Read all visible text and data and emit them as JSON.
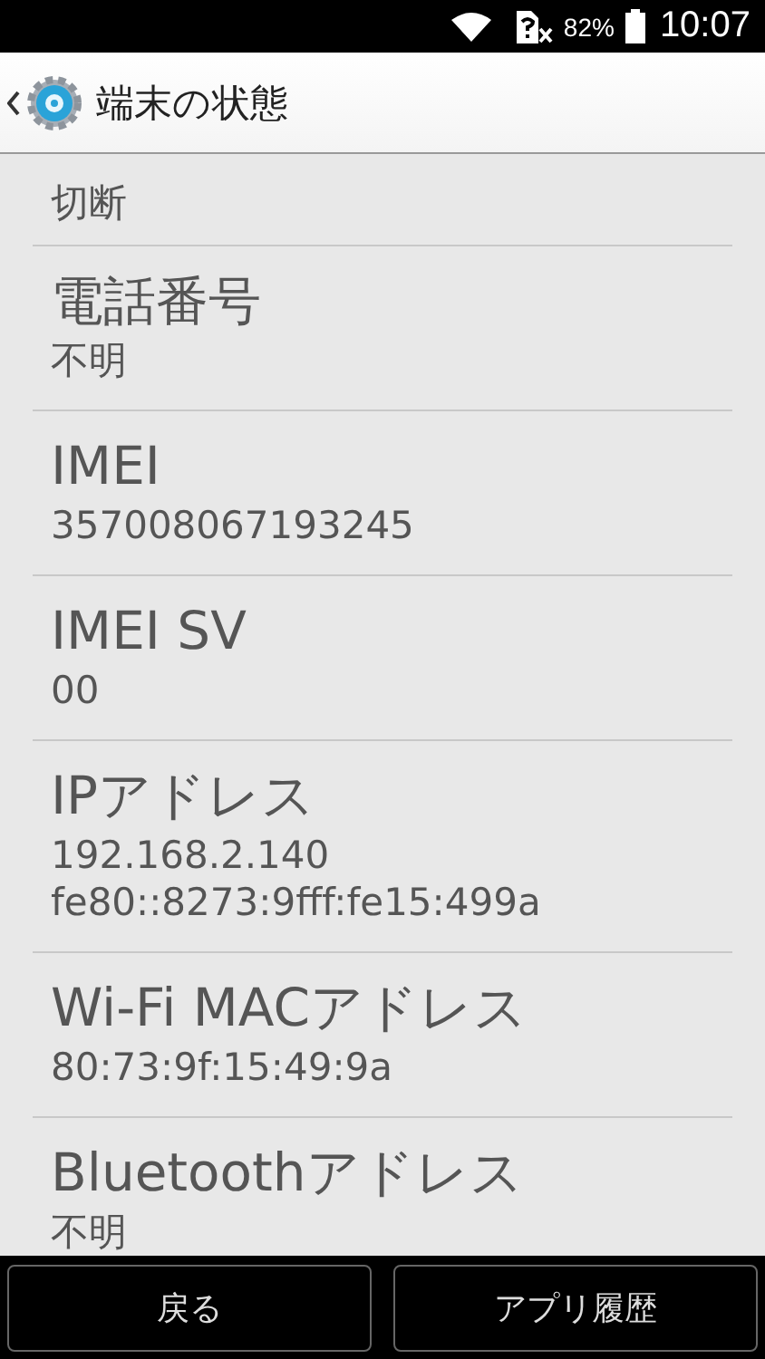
{
  "status_bar": {
    "battery_text": "82%",
    "time": "10:07"
  },
  "header": {
    "title": "端末の状態"
  },
  "items": [
    {
      "values": [
        "切断"
      ]
    },
    {
      "label": "電話番号",
      "values": [
        "不明"
      ]
    },
    {
      "label": "IMEI",
      "values": [
        "357008067193245"
      ]
    },
    {
      "label": "IMEI SV",
      "values": [
        "00"
      ]
    },
    {
      "label": "IPアドレス",
      "values": [
        "192.168.2.140",
        "fe80::8273:9fff:fe15:499a"
      ]
    },
    {
      "label": "Wi-Fi MACアドレス",
      "values": [
        "80:73:9f:15:49:9a"
      ]
    },
    {
      "label": "Bluetoothアドレス",
      "values": [
        "不明"
      ]
    }
  ],
  "buttons": [
    "戻る",
    "アプリ履歴"
  ]
}
